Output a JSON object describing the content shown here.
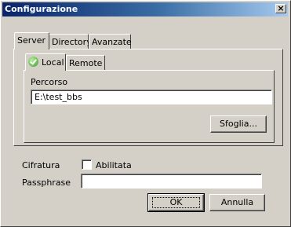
{
  "window": {
    "title": "Configurazione",
    "close_label": "×"
  },
  "outer_tabs": [
    {
      "label": "Server",
      "active": true
    },
    {
      "label": "Directory",
      "active": false
    },
    {
      "label": "Avanzate",
      "active": false
    }
  ],
  "inner_tabs": [
    {
      "label": "Local",
      "active": true,
      "icon": "green-check-icon"
    },
    {
      "label": "Remote",
      "active": false
    }
  ],
  "local": {
    "path_label": "Percorso",
    "path_value": "E:\\test_bbs",
    "browse_label": "Sfoglia..."
  },
  "encryption": {
    "label": "Cifratura",
    "checkbox_label": "Abilitata",
    "checked": false,
    "passphrase_label": "Passphrase",
    "passphrase_value": ""
  },
  "buttons": {
    "ok": "OK",
    "cancel": "Annulla"
  }
}
